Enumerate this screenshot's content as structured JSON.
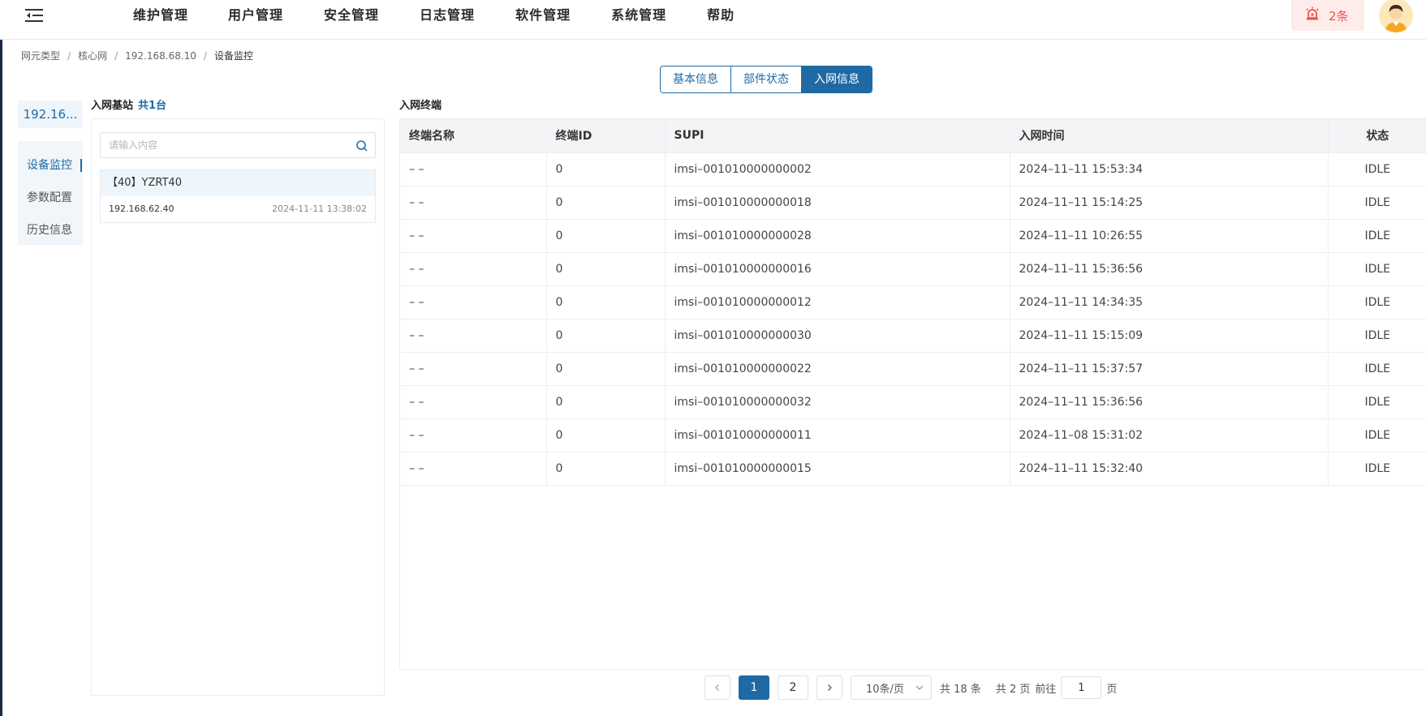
{
  "nav": {
    "items": [
      "维护管理",
      "用户管理",
      "安全管理",
      "日志管理",
      "软件管理",
      "系统管理",
      "帮助"
    ]
  },
  "alarm": {
    "count_label": "2条",
    "color": "#e8574f"
  },
  "breadcrumb": [
    "网元类型",
    "核心网",
    "192.168.68.10",
    "设备监控"
  ],
  "tabs": {
    "items": [
      "基本信息",
      "部件状态",
      "入网信息"
    ],
    "active": "入网信息"
  },
  "device": {
    "label": "192.16..."
  },
  "sidenav": {
    "items": [
      "设备监控",
      "参数配置",
      "历史信息"
    ],
    "active": "设备监控"
  },
  "base_station": {
    "title": "入网基站",
    "count_label": "共1台",
    "search_placeholder": "请输入内容",
    "cards": [
      {
        "name": "【40】YZRT40",
        "ip": "192.168.62.40",
        "time": "2024-11-11 13:38:02"
      }
    ]
  },
  "terminals": {
    "title": "入网终端",
    "columns": [
      "终端名称",
      "终端ID",
      "SUPI",
      "入网时间",
      "状态"
    ],
    "rows": [
      [
        "– –",
        "0",
        "imsi–001010000000002",
        "2024–11–11 15:53:34",
        "IDLE"
      ],
      [
        "– –",
        "0",
        "imsi–001010000000018",
        "2024–11–11 15:14:25",
        "IDLE"
      ],
      [
        "– –",
        "0",
        "imsi–001010000000028",
        "2024–11–11 10:26:55",
        "IDLE"
      ],
      [
        "– –",
        "0",
        "imsi–001010000000016",
        "2024–11–11 15:36:56",
        "IDLE"
      ],
      [
        "– –",
        "0",
        "imsi–001010000000012",
        "2024–11–11 14:34:35",
        "IDLE"
      ],
      [
        "– –",
        "0",
        "imsi–001010000000030",
        "2024–11–11 15:15:09",
        "IDLE"
      ],
      [
        "– –",
        "0",
        "imsi–001010000000022",
        "2024–11–11 15:37:57",
        "IDLE"
      ],
      [
        "– –",
        "0",
        "imsi–001010000000032",
        "2024–11–11 15:36:56",
        "IDLE"
      ],
      [
        "– –",
        "0",
        "imsi–001010000000011",
        "2024–11–08 15:31:02",
        "IDLE"
      ],
      [
        "– –",
        "0",
        "imsi–001010000000015",
        "2024–11–11 15:32:40",
        "IDLE"
      ]
    ]
  },
  "pagination": {
    "pages": [
      "1",
      "2"
    ],
    "current": "1",
    "page_size": "10条/页",
    "total_label": "共 18 条",
    "pages_label": "共 2 页",
    "goto_label": "前往",
    "goto_value": "1",
    "goto_suffix": "页"
  },
  "colors": {
    "primary": "#1f6aa5",
    "alarm_bg": "#fdecea",
    "header_bg": "#f3f4f6"
  }
}
